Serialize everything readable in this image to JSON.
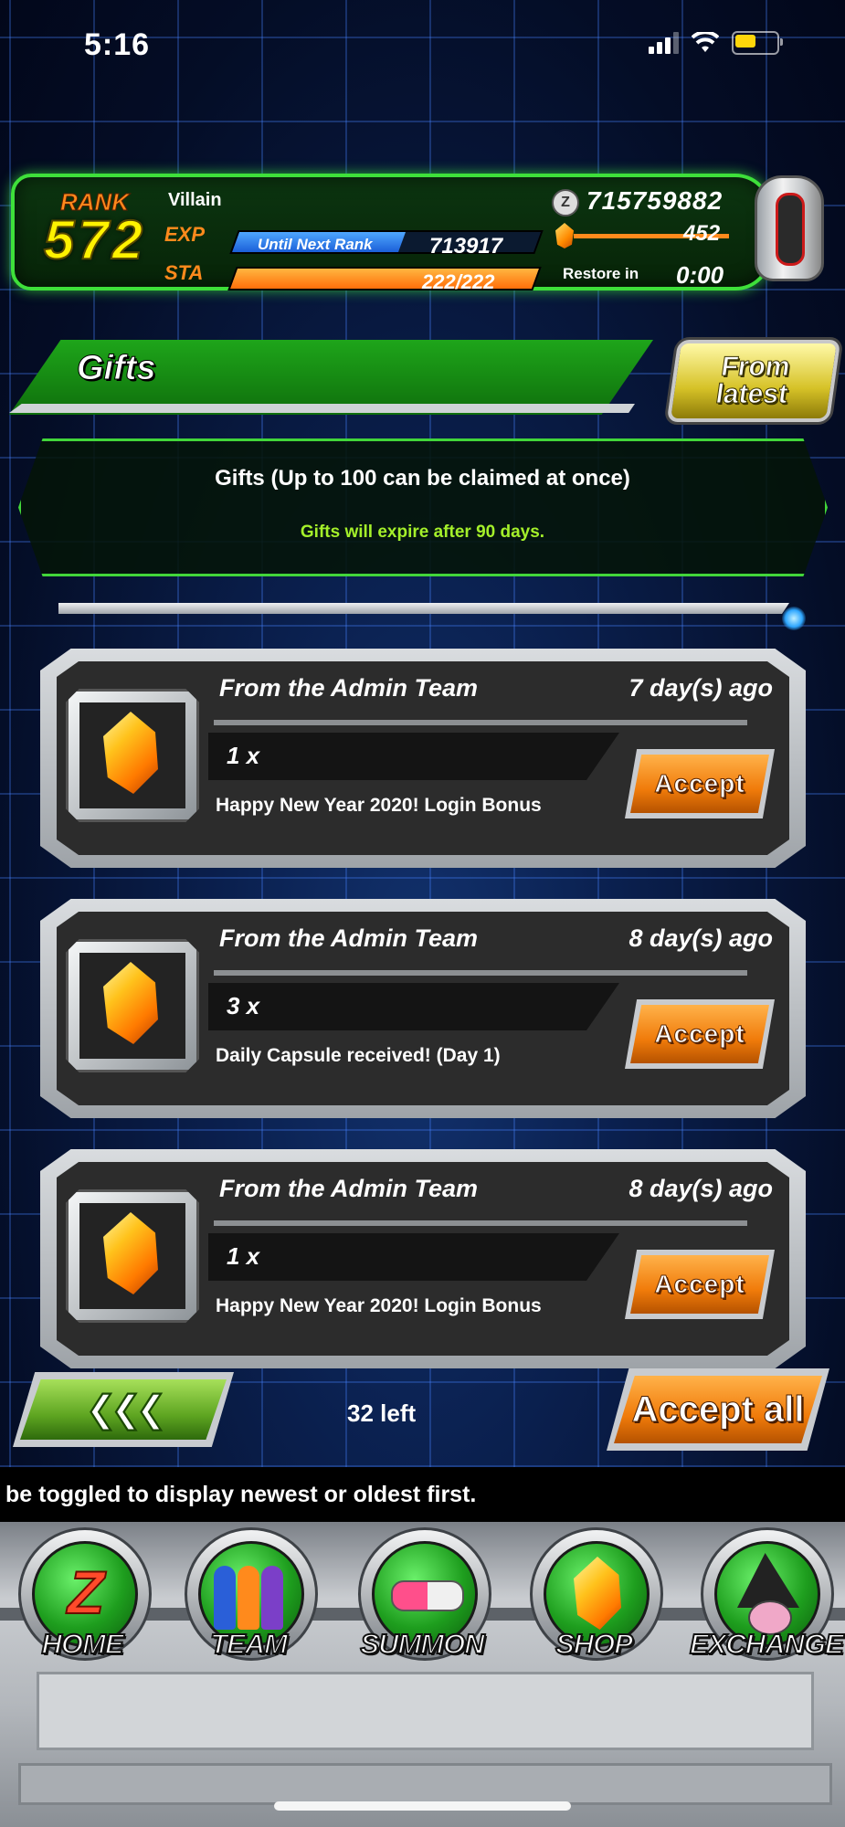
{
  "status_bar": {
    "time": "5:16"
  },
  "player": {
    "rank_label": "RANK",
    "rank": "572",
    "title": "Villain",
    "exp_label": "EXP",
    "sta_label": "STA",
    "until_next_rank_label": "Until Next Rank",
    "exp_to_next": "713917",
    "stamina": "222/222",
    "zeni": "715759882",
    "dragon_stones": "452",
    "restore_label": "Restore in",
    "restore_time": "0:00"
  },
  "gifts": {
    "title": "Gifts",
    "sort_line1": "From",
    "sort_line2": "latest",
    "info_title": "Gifts (Up to 100 can be claimed at once)",
    "info_note": "Gifts will expire after 90 days.",
    "items": [
      {
        "sender": "From the Admin Team",
        "time": "7 day(s) ago",
        "quantity": "1 x",
        "description": "Happy New Year 2020! Login Bonus",
        "accept_label": "Accept"
      },
      {
        "sender": "From the Admin Team",
        "time": "8 day(s) ago",
        "quantity": "3 x",
        "description": "Daily Capsule received! (Day 1)",
        "accept_label": "Accept"
      },
      {
        "sender": "From the Admin Team",
        "time": "8 day(s) ago",
        "quantity": "1 x",
        "description": "Happy New Year 2020! Login Bonus",
        "accept_label": "Accept"
      }
    ],
    "back_label": "❮❮❮",
    "remaining": "32 left",
    "accept_all_label": "Accept all"
  },
  "ticker": "be toggled to display newest or oldest first.",
  "nav": [
    {
      "label": "HOME",
      "icon": "home-z-icon"
    },
    {
      "label": "TEAM",
      "icon": "team-icon"
    },
    {
      "label": "SUMMON",
      "icon": "summon-capsule-icon"
    },
    {
      "label": "SHOP",
      "icon": "dragon-stone-icon"
    },
    {
      "label": "EXCHANGE",
      "icon": "exchange-icon"
    }
  ],
  "colors": {
    "panel_border": "#3ee03a",
    "rank_number": "#fff200",
    "label_orange": "#ff8a1c",
    "info_note": "#a4f02a",
    "accept_button": "#f07b0a",
    "back_button": "#5ea521"
  }
}
